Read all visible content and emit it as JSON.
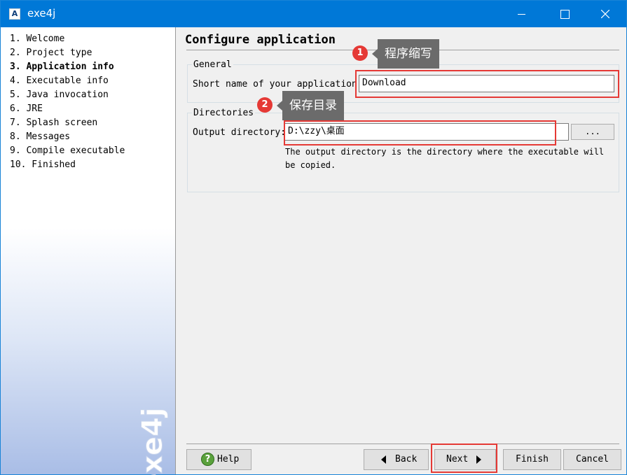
{
  "window": {
    "title": "exe4j",
    "icon": "exe4j-app-icon",
    "icon_glyph": "A"
  },
  "steps": [
    {
      "label": "1. Welcome",
      "active": false
    },
    {
      "label": "2. Project type",
      "active": false
    },
    {
      "label": "3. Application info",
      "active": true
    },
    {
      "label": "4. Executable info",
      "active": false
    },
    {
      "label": "5. Java invocation",
      "active": false
    },
    {
      "label": "6. JRE",
      "active": false
    },
    {
      "label": "7. Splash screen",
      "active": false
    },
    {
      "label": "8. Messages",
      "active": false
    },
    {
      "label": "9. Compile executable",
      "active": false
    },
    {
      "label": "10. Finished",
      "active": false
    }
  ],
  "watermark": "exe4j",
  "main": {
    "page_title": "Configure application",
    "general": {
      "legend": "General",
      "short_name_label": "Short name of your application:",
      "short_name_value": "Download"
    },
    "directories": {
      "legend": "Directories",
      "output_label": "Output directory:",
      "output_value": "D:\\zzy\\桌面",
      "browse_label": "...",
      "hint": "The output directory is the directory where the executable will be copied."
    }
  },
  "annotations": [
    {
      "number": "1",
      "text": "程序缩写"
    },
    {
      "number": "2",
      "text": "保存目录"
    }
  ],
  "buttons": {
    "help": "Help",
    "back": "Back",
    "next": "Next",
    "finish": "Finish",
    "cancel": "Cancel"
  },
  "colors": {
    "titlebar": "#0078d7",
    "highlight": "#e53935",
    "callout": "#6b6b6b"
  }
}
